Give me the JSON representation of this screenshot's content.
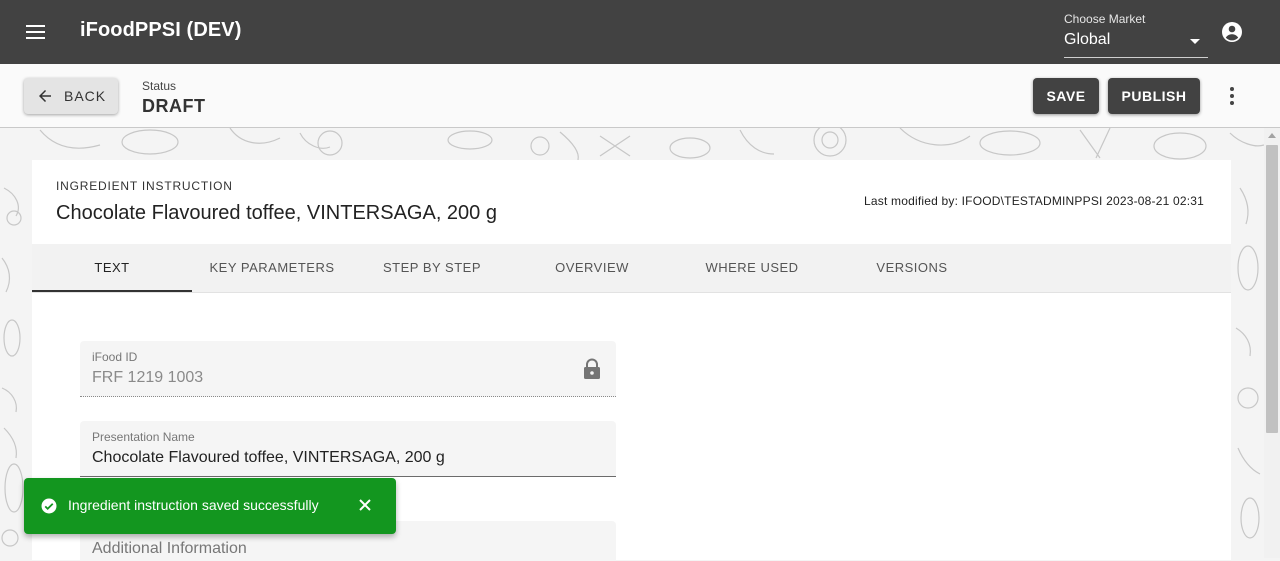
{
  "appbar": {
    "title": "iFoodPPSI (DEV)",
    "market_label": "Choose Market",
    "market_value": "Global"
  },
  "toolbar": {
    "back_label": "BACK",
    "status_label": "Status",
    "status_value": "DRAFT",
    "save_label": "SAVE",
    "publish_label": "PUBLISH"
  },
  "card": {
    "overline": "INGREDIENT INSTRUCTION",
    "title": "Chocolate Flavoured toffee, VINTERSAGA, 200 g",
    "last_modified": "Last modified by: IFOOD\\TESTADMINPPSI 2023-08-21 02:31",
    "tabs": [
      {
        "label": "TEXT",
        "active": true
      },
      {
        "label": "KEY PARAMETERS",
        "active": false
      },
      {
        "label": "STEP BY STEP",
        "active": false
      },
      {
        "label": "OVERVIEW",
        "active": false
      },
      {
        "label": "WHERE USED",
        "active": false
      },
      {
        "label": "VERSIONS",
        "active": false
      }
    ],
    "fields": {
      "ifood_id": {
        "label": "iFood ID",
        "value": "FRF 1219 1003",
        "locked": true
      },
      "presentation_name": {
        "label": "Presentation Name",
        "value": "Chocolate Flavoured toffee, VINTERSAGA, 200 g"
      },
      "additional_information": {
        "placeholder": "Additional Information"
      }
    }
  },
  "snackbar": {
    "message": "Ingredient instruction saved successfully",
    "color": "#13961f"
  },
  "colors": {
    "appbar": "#424242",
    "toolbar": "#fafafa",
    "primary_button": "#424242"
  },
  "icons": [
    "menu-icon",
    "account-circle-icon",
    "arrow-back-icon",
    "more-vert-icon",
    "lock-icon",
    "check-circle-icon",
    "close-icon"
  ]
}
